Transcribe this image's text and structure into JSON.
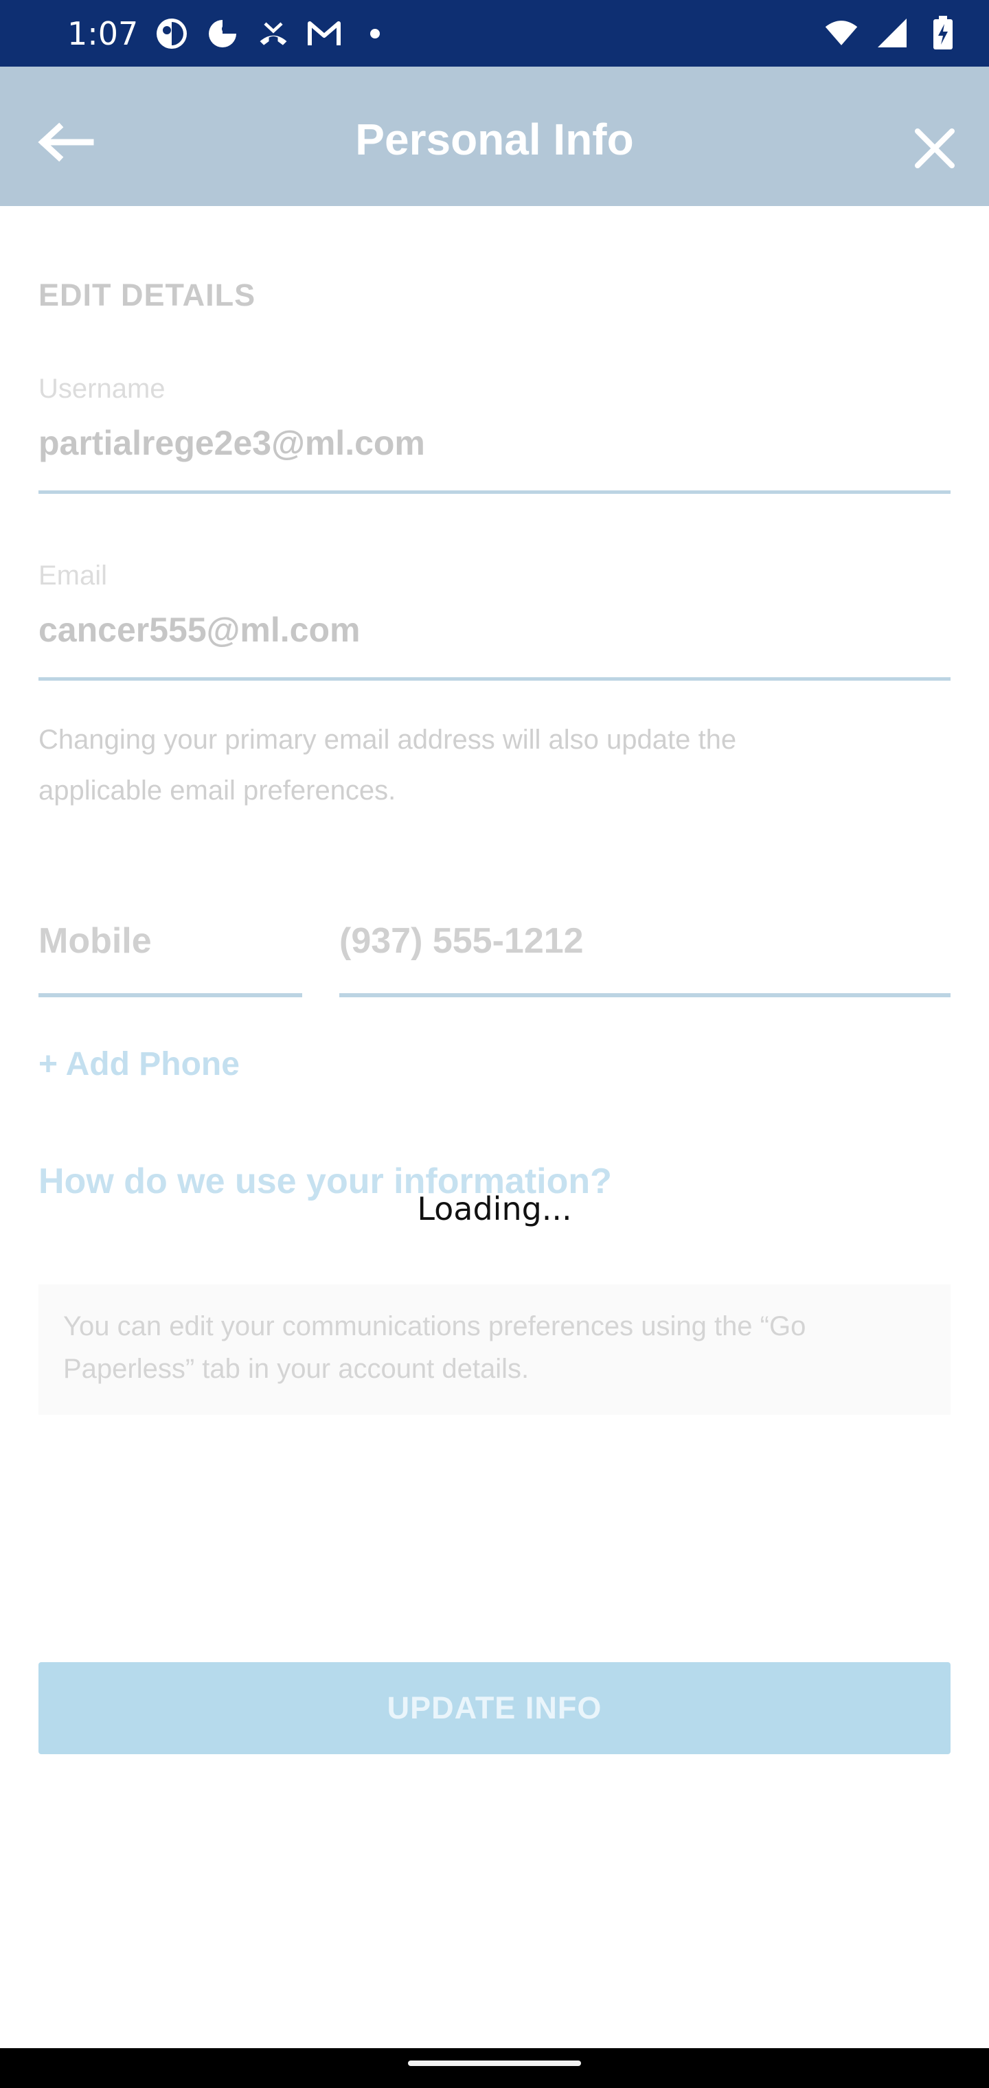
{
  "status_bar": {
    "time": "1:07",
    "left_icons": [
      "pinwheel-icon",
      "pinwheel-outline-icon",
      "missed-call-icon",
      "gmail-icon",
      "dot-icon"
    ],
    "right_icons": [
      "wifi-icon",
      "cellular-signal-icon",
      "battery-charging-icon"
    ]
  },
  "app_bar": {
    "title": "Personal Info",
    "back_icon": "arrow-left-icon",
    "close_icon": "close-icon"
  },
  "form": {
    "section_title": "EDIT DETAILS",
    "username": {
      "label": "Username",
      "value": "partialrege2e3@ml.com"
    },
    "email": {
      "label": "Email",
      "value": "cancer555@ml.com"
    },
    "email_hint": "Changing your primary email address will also update the applicable email preferences.",
    "phone": {
      "type": "Mobile",
      "number": "(937) 555-1212"
    },
    "add_phone_label": "+ Add Phone",
    "info_link": "How do we use your information?",
    "note": "You can edit your communications preferences using the “Go Paperless” tab in your account details.",
    "update_button": "UPDATE INFO"
  },
  "overlay": {
    "loading_text": "Loading..."
  },
  "colors": {
    "status_bar": "#0e2f72",
    "app_bar": "#b3c7d7",
    "accent_faded": "#b6daec"
  }
}
